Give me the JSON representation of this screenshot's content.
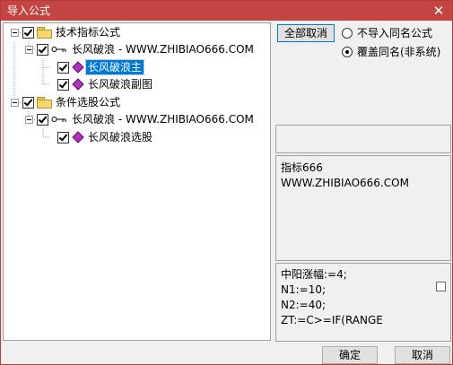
{
  "window": {
    "title": "导入公式",
    "close_glyph": "✕"
  },
  "tree": {
    "nodes": [
      {
        "label": "技术指标公式",
        "type": "folder",
        "checked": true,
        "icon": "folder-icon"
      },
      {
        "label": "长风破浪 - WWW.ZHIBIAO666.COM",
        "type": "key",
        "checked": true,
        "icon": "key-icon"
      },
      {
        "label": "长风破浪主",
        "type": "formula",
        "checked": true,
        "selected": true,
        "icon": "diamond-icon"
      },
      {
        "label": "长风破浪副图",
        "type": "formula",
        "checked": true,
        "icon": "diamond-icon"
      },
      {
        "label": "条件选股公式",
        "type": "folder",
        "checked": true,
        "icon": "folder-icon"
      },
      {
        "label": "长风破浪 - WWW.ZHIBIAO666.COM",
        "type": "key",
        "checked": true,
        "icon": "key-icon"
      },
      {
        "label": "长风破浪选股",
        "type": "formula",
        "checked": true,
        "icon": "diamond-icon"
      }
    ]
  },
  "options": {
    "deselect_all_label": "全部取消",
    "radio_no_import": "不导入同名公式",
    "radio_overwrite": "覆盖同名(非系统)",
    "selected": "overwrite"
  },
  "description": {
    "line1": "指标666",
    "line2": "WWW.ZHIBIAO666.COM"
  },
  "code": {
    "lines": [
      "中阳涨幅:=4;",
      "N1:=10;",
      "N2:=40;",
      "ZT:=C>=IF(RANGE"
    ]
  },
  "footer": {
    "ok_label": "确定",
    "cancel_label": "取消"
  },
  "colors": {
    "titlebar": "#c44442",
    "selection": "#0078d7",
    "diamond": "#b030c0"
  }
}
